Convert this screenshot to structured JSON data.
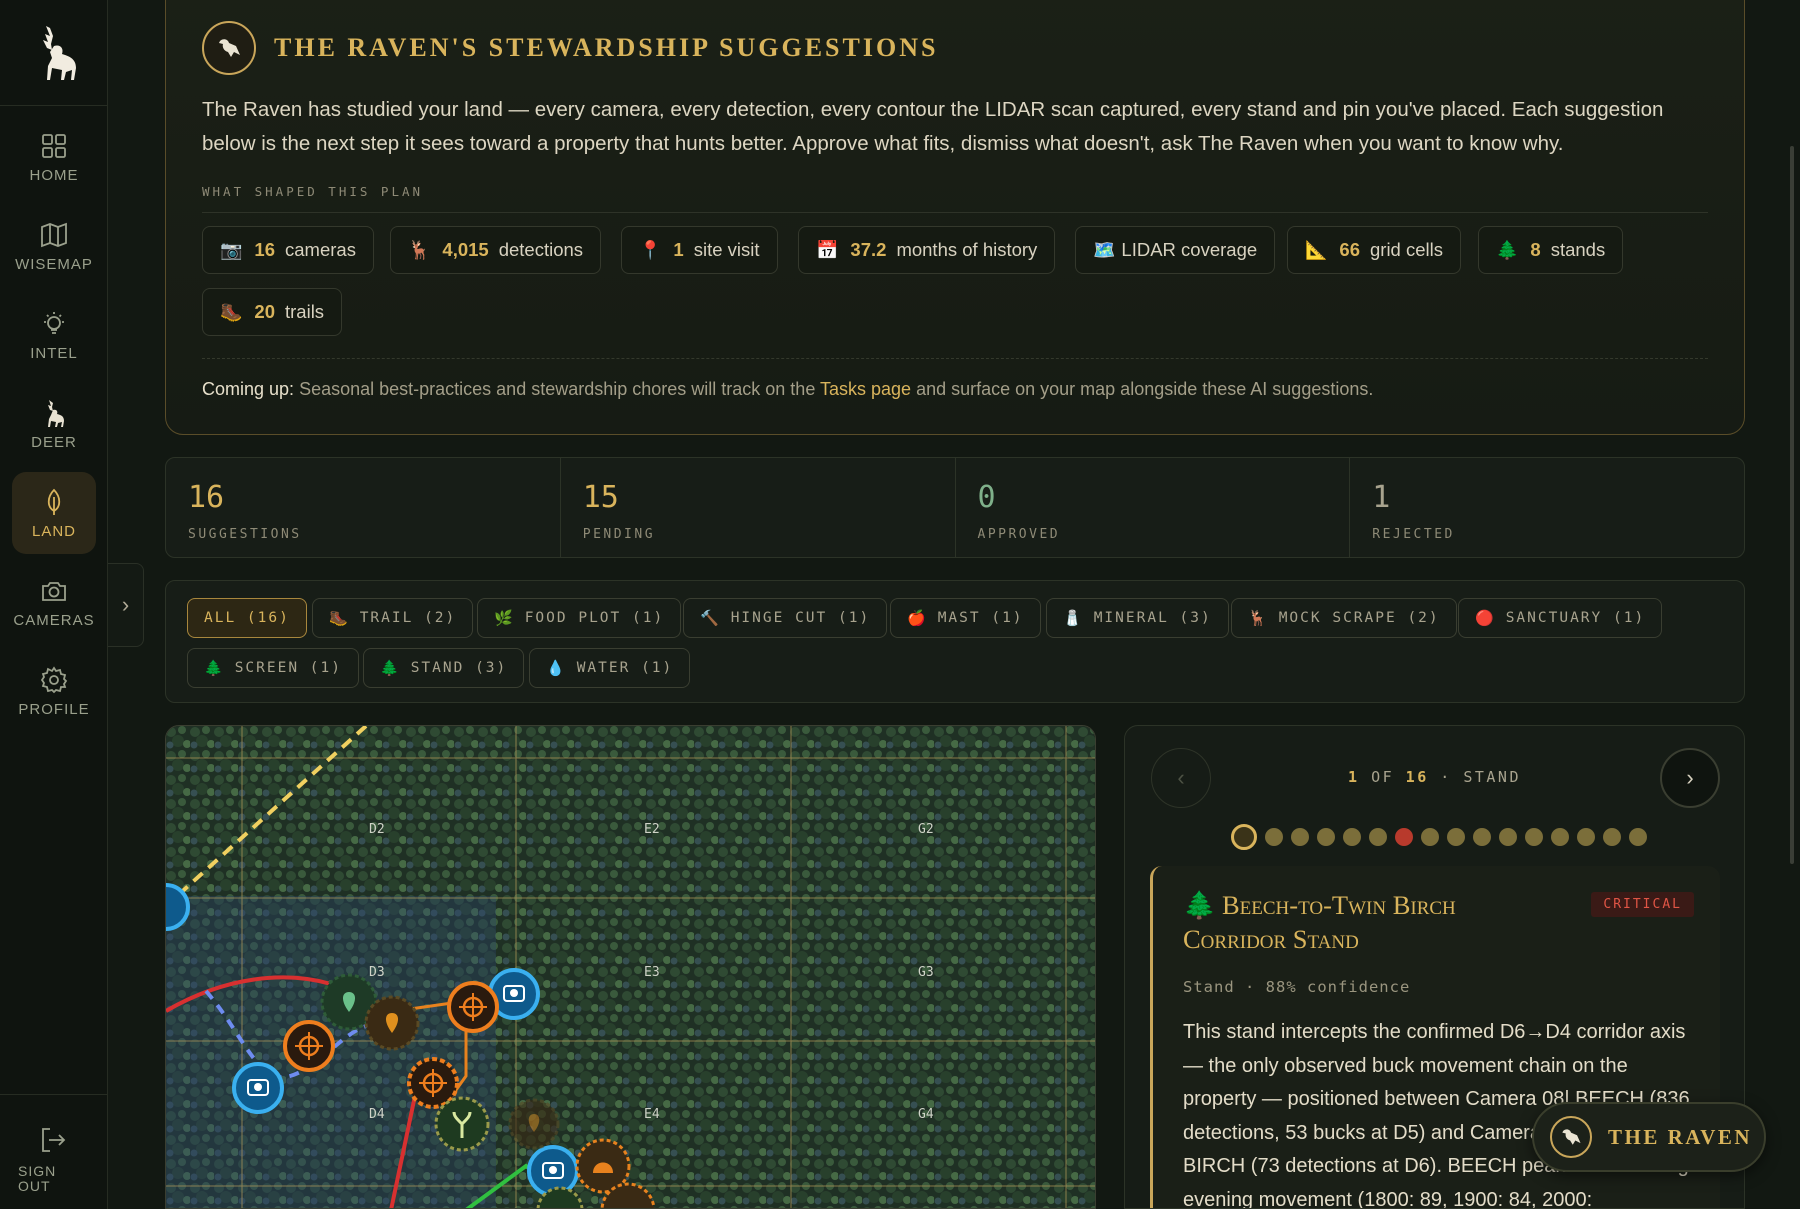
{
  "sidebar": {
    "items": [
      {
        "label": "HOME",
        "icon": "grid-icon"
      },
      {
        "label": "WISEMAP",
        "icon": "map-icon"
      },
      {
        "label": "INTEL",
        "icon": "lightbulb-icon"
      },
      {
        "label": "DEER",
        "icon": "deer-icon"
      },
      {
        "label": "LAND",
        "icon": "leaf-icon",
        "active": true
      },
      {
        "label": "CAMERAS",
        "icon": "camera-icon"
      },
      {
        "label": "PROFILE",
        "icon": "gear-icon"
      }
    ],
    "signout": "SIGN OUT"
  },
  "hero": {
    "title": "THE RAVEN'S STEWARDSHIP SUGGESTIONS",
    "description": "The Raven has studied your land — every camera, every detection, every contour the LIDAR scan captured, every stand and pin you've placed. Each suggestion below is the next step it sees toward a property that hunts better. Approve what fits, dismiss what doesn't, ask The Raven when you want to know why.",
    "shaped_label": "WHAT SHAPED THIS PLAN",
    "chips": [
      {
        "icon": "📷",
        "num": "16",
        "label": "cameras"
      },
      {
        "icon": "🦌",
        "num": "4,015",
        "label": "detections"
      },
      {
        "icon": "📍",
        "num": "1",
        "label": "site visit"
      },
      {
        "icon": "📅",
        "num": "37.2",
        "label": "months of history"
      },
      {
        "icon": "🗺️",
        "num": "",
        "label": "LIDAR coverage"
      },
      {
        "icon": "📐",
        "num": "66",
        "label": "grid cells"
      },
      {
        "icon": "🌲",
        "num": "8",
        "label": "stands"
      },
      {
        "icon": "🥾",
        "num": "20",
        "label": "trails"
      }
    ],
    "coming_label": "Coming up:",
    "coming_before": " Seasonal best-practices and stewardship chores will track on the ",
    "coming_link": "Tasks page",
    "coming_after": " and surface on your map alongside these AI suggestions."
  },
  "stats": [
    {
      "value": "16",
      "label": "SUGGESTIONS",
      "color": "#d9b45c"
    },
    {
      "value": "15",
      "label": "PENDING",
      "color": "#d9b45c"
    },
    {
      "value": "0",
      "label": "APPROVED",
      "color": "#7fb08a"
    },
    {
      "value": "1",
      "label": "REJECTED",
      "color": "#a8a38e"
    }
  ],
  "filters": [
    {
      "icon": "",
      "label": "ALL (16)",
      "active": true
    },
    {
      "icon": "🥾",
      "label": "TRAIL (2)"
    },
    {
      "icon": "🌿",
      "label": "FOOD PLOT (1)"
    },
    {
      "icon": "🔨",
      "label": "HINGE CUT (1)"
    },
    {
      "icon": "🍎",
      "label": "MAST (1)"
    },
    {
      "icon": "🧂",
      "label": "MINERAL (3)"
    },
    {
      "icon": "🦌",
      "label": "MOCK SCRAPE (2)"
    },
    {
      "icon": "🔴",
      "label": "SANCTUARY (1)"
    },
    {
      "icon": "🌲",
      "label": "SCREEN (1)"
    },
    {
      "icon": "🌲",
      "label": "STAND (3)"
    },
    {
      "icon": "💧",
      "label": "WATER (1)"
    }
  ],
  "map": {
    "grid_labels": [
      "D2",
      "E2",
      "G2",
      "D3",
      "E3",
      "G3",
      "D4",
      "E4",
      "G4"
    ]
  },
  "suggestion": {
    "current": "1",
    "total": "16",
    "of": "OF",
    "category": "STAND",
    "prev": "‹",
    "next": "›",
    "icon": "🌲",
    "title": "Beech-to-Twin Birch Corridor Stand",
    "severity": "CRITICAL",
    "meta": "Stand · 88% confidence",
    "body": "This stand intercepts the confirmed D6→D4 corridor axis — the only observed buck movement chain on the property — positioned between Camera 08| BEECH (836 detections, 53 bucks at D5) and Camera 09| TWIN BIRCH (73 detections at D6). BEECH peaks show strong evening movement (1800: 89, 1900: 84, 2000:"
  },
  "raven_button": "THE RAVEN",
  "colors": {
    "accent": "#d9b45c",
    "critical": "#e05545",
    "background": "#121812"
  }
}
